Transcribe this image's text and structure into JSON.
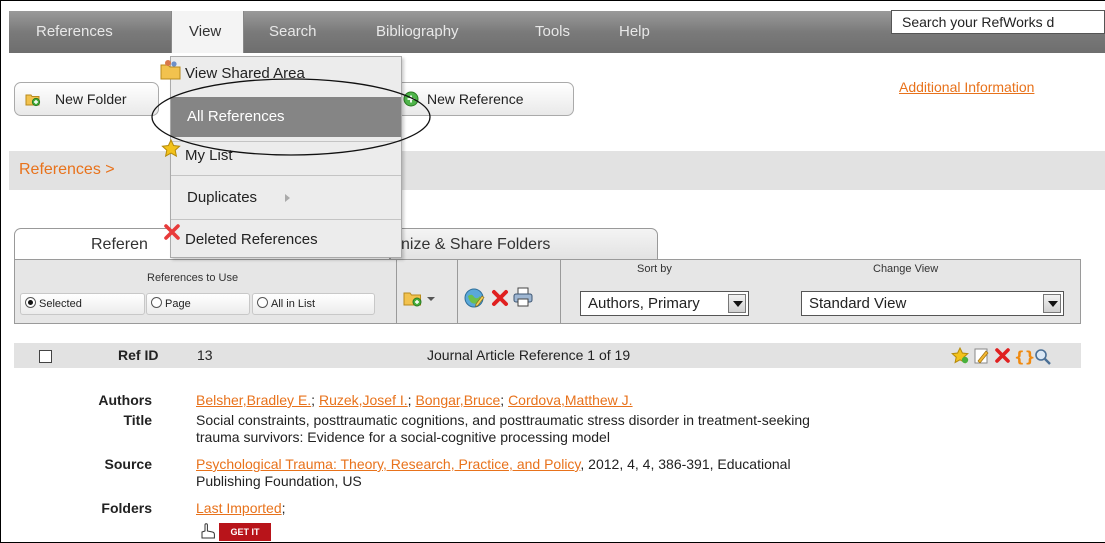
{
  "menubar": {
    "items": [
      "References",
      "View",
      "Search",
      "Bibliography",
      "Tools",
      "Help"
    ],
    "search_value": "Search your RefWorks d"
  },
  "toolbar": {
    "new_folder": "New Folder",
    "new_reference": "New Reference",
    "additional_info": "Additional Information"
  },
  "view_menu": {
    "view_shared_area": "View Shared Area",
    "all_references": "All References",
    "my_list": "My List",
    "duplicates": "Duplicates",
    "deleted_references": "Deleted References"
  },
  "breadcrumb": {
    "text": "References >"
  },
  "tabs": {
    "references": "Referen",
    "organize": "nize & Share Folders"
  },
  "panel": {
    "references_to_use": "References to Use",
    "selected": "Selected",
    "page": "Page",
    "all_in_list": "All in List",
    "sort_by_label": "Sort by",
    "sort_by_value": "Authors, Primary",
    "change_view_label": "Change View",
    "change_view_value": "Standard View"
  },
  "reference": {
    "ref_id_label": "Ref ID",
    "ref_id": "13",
    "type_line": "Journal Article Reference 1 of 19",
    "authors_label": "Authors",
    "authors": [
      "Belsher,Bradley E.",
      "Ruzek,Josef I.",
      "Bongar,Bruce",
      "Cordova,Matthew J."
    ],
    "title_label": "Title",
    "title_line1": "Social constraints, posttraumatic cognitions, and posttraumatic stress disorder in treatment-seeking",
    "title_line2": "trauma survivors: Evidence for a social-cognitive processing model",
    "source_label": "Source",
    "source_link": "Psychological Trauma: Theory, Research, Practice, and Policy",
    "source_rest": ", 2012, 4, 4, 386-391, Educational",
    "source_line2": "Publishing Foundation, US",
    "folders_label": "Folders",
    "folder_link": "Last Imported",
    "folder_sep": ";",
    "get_it": "GET IT"
  },
  "colors": {
    "link_orange": "#e8721b",
    "menubar_gray": "#7a7a7a",
    "highlight_gray": "#858585"
  }
}
